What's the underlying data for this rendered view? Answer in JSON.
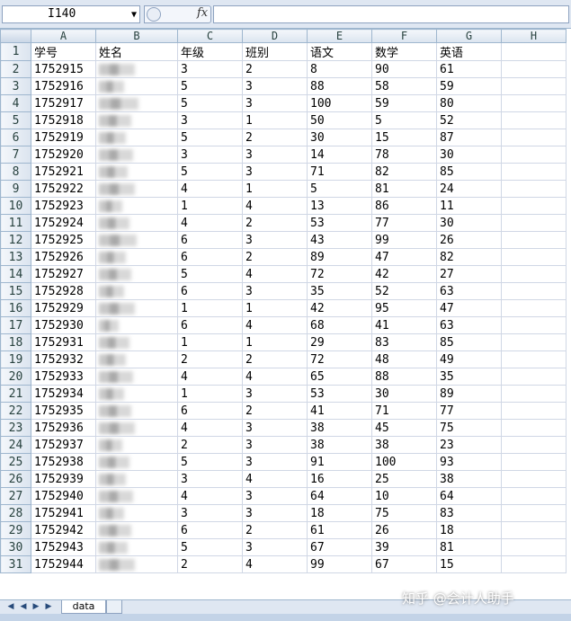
{
  "formula_bar": {
    "name_box": "I140",
    "fx_label": "fx",
    "formula": ""
  },
  "columns": [
    "A",
    "B",
    "C",
    "D",
    "E",
    "F",
    "G",
    "H"
  ],
  "header": [
    "学号",
    "姓名",
    "年级",
    "班别",
    "语文",
    "数学",
    "英语",
    ""
  ],
  "rows": [
    {
      "id": "1752915",
      "grade": "3",
      "cls": "2",
      "chinese": "8",
      "math": "90",
      "english": "61"
    },
    {
      "id": "1752916",
      "grade": "5",
      "cls": "3",
      "chinese": "88",
      "math": "58",
      "english": "59"
    },
    {
      "id": "1752917",
      "grade": "5",
      "cls": "3",
      "chinese": "100",
      "math": "59",
      "english": "80"
    },
    {
      "id": "1752918",
      "grade": "3",
      "cls": "1",
      "chinese": "50",
      "math": "5",
      "english": "52"
    },
    {
      "id": "1752919",
      "grade": "5",
      "cls": "2",
      "chinese": "30",
      "math": "15",
      "english": "87"
    },
    {
      "id": "1752920",
      "grade": "3",
      "cls": "3",
      "chinese": "14",
      "math": "78",
      "english": "30"
    },
    {
      "id": "1752921",
      "grade": "5",
      "cls": "3",
      "chinese": "71",
      "math": "82",
      "english": "85"
    },
    {
      "id": "1752922",
      "grade": "4",
      "cls": "1",
      "chinese": "5",
      "math": "81",
      "english": "24"
    },
    {
      "id": "1752923",
      "grade": "1",
      "cls": "4",
      "chinese": "13",
      "math": "86",
      "english": "11"
    },
    {
      "id": "1752924",
      "grade": "4",
      "cls": "2",
      "chinese": "53",
      "math": "77",
      "english": "30"
    },
    {
      "id": "1752925",
      "grade": "6",
      "cls": "3",
      "chinese": "43",
      "math": "99",
      "english": "26"
    },
    {
      "id": "1752926",
      "grade": "6",
      "cls": "2",
      "chinese": "89",
      "math": "47",
      "english": "82"
    },
    {
      "id": "1752927",
      "grade": "5",
      "cls": "4",
      "chinese": "72",
      "math": "42",
      "english": "27"
    },
    {
      "id": "1752928",
      "grade": "6",
      "cls": "3",
      "chinese": "35",
      "math": "52",
      "english": "63"
    },
    {
      "id": "1752929",
      "grade": "1",
      "cls": "1",
      "chinese": "42",
      "math": "95",
      "english": "47"
    },
    {
      "id": "1752930",
      "grade": "6",
      "cls": "4",
      "chinese": "68",
      "math": "41",
      "english": "63"
    },
    {
      "id": "1752931",
      "grade": "1",
      "cls": "1",
      "chinese": "29",
      "math": "83",
      "english": "85"
    },
    {
      "id": "1752932",
      "grade": "2",
      "cls": "2",
      "chinese": "72",
      "math": "48",
      "english": "49"
    },
    {
      "id": "1752933",
      "grade": "4",
      "cls": "4",
      "chinese": "65",
      "math": "88",
      "english": "35"
    },
    {
      "id": "1752934",
      "grade": "1",
      "cls": "3",
      "chinese": "53",
      "math": "30",
      "english": "89"
    },
    {
      "id": "1752935",
      "grade": "6",
      "cls": "2",
      "chinese": "41",
      "math": "71",
      "english": "77"
    },
    {
      "id": "1752936",
      "grade": "4",
      "cls": "3",
      "chinese": "38",
      "math": "45",
      "english": "75"
    },
    {
      "id": "1752937",
      "grade": "2",
      "cls": "3",
      "chinese": "38",
      "math": "38",
      "english": "23"
    },
    {
      "id": "1752938",
      "grade": "5",
      "cls": "3",
      "chinese": "91",
      "math": "100",
      "english": "93"
    },
    {
      "id": "1752939",
      "grade": "3",
      "cls": "4",
      "chinese": "16",
      "math": "25",
      "english": "38"
    },
    {
      "id": "1752940",
      "grade": "4",
      "cls": "3",
      "chinese": "64",
      "math": "10",
      "english": "64"
    },
    {
      "id": "1752941",
      "grade": "3",
      "cls": "3",
      "chinese": "18",
      "math": "75",
      "english": "83"
    },
    {
      "id": "1752942",
      "grade": "6",
      "cls": "2",
      "chinese": "61",
      "math": "26",
      "english": "18"
    },
    {
      "id": "1752943",
      "grade": "5",
      "cls": "3",
      "chinese": "67",
      "math": "39",
      "english": "81"
    },
    {
      "id": "1752944",
      "grade": "2",
      "cls": "4",
      "chinese": "99",
      "math": "67",
      "english": "15"
    }
  ],
  "sheet_tabs": [
    "data"
  ],
  "watermark": "知乎 @会计人助手"
}
